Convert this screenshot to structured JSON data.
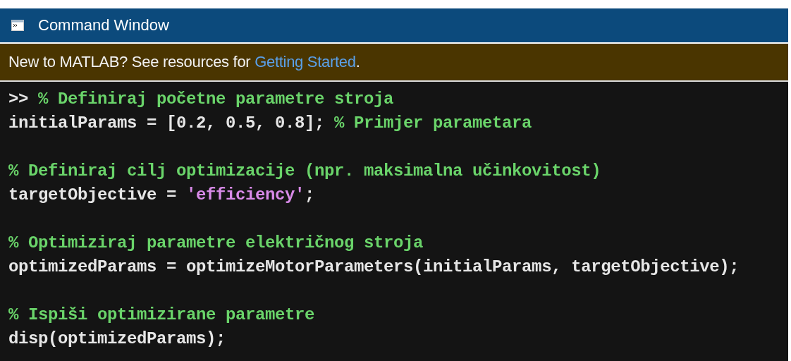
{
  "window": {
    "title": "Command Window"
  },
  "banner": {
    "text": "New to MATLAB? See resources for ",
    "link": "Getting Started",
    "suffix": "."
  },
  "blocks": [
    [
      [
        {
          "kind": "prompt",
          "text": ">> "
        },
        {
          "kind": "comment",
          "text": "% Definiraj početne parametre stroja"
        }
      ],
      [
        {
          "kind": "code",
          "text": "initialParams = [0.2, 0.5, 0.8]; "
        },
        {
          "kind": "comment",
          "text": "% Primjer parametara"
        }
      ]
    ],
    [
      [
        {
          "kind": "comment",
          "text": "% Definiraj cilj optimizacije (npr. maksimalna učinkovitost)"
        }
      ],
      [
        {
          "kind": "code",
          "text": "targetObjective = "
        },
        {
          "kind": "string",
          "text": "'efficiency'"
        },
        {
          "kind": "code",
          "text": ";"
        }
      ]
    ],
    [
      [
        {
          "kind": "comment",
          "text": "% Optimiziraj parametre električnog stroja"
        }
      ],
      [
        {
          "kind": "code",
          "text": "optimizedParams = optimizeMotorParameters(initialParams, targetObjective);"
        }
      ]
    ],
    [
      [
        {
          "kind": "comment",
          "text": "% Ispiši optimizirane parametre"
        }
      ],
      [
        {
          "kind": "code",
          "text": "disp(optimizedParams);"
        }
      ]
    ]
  ]
}
